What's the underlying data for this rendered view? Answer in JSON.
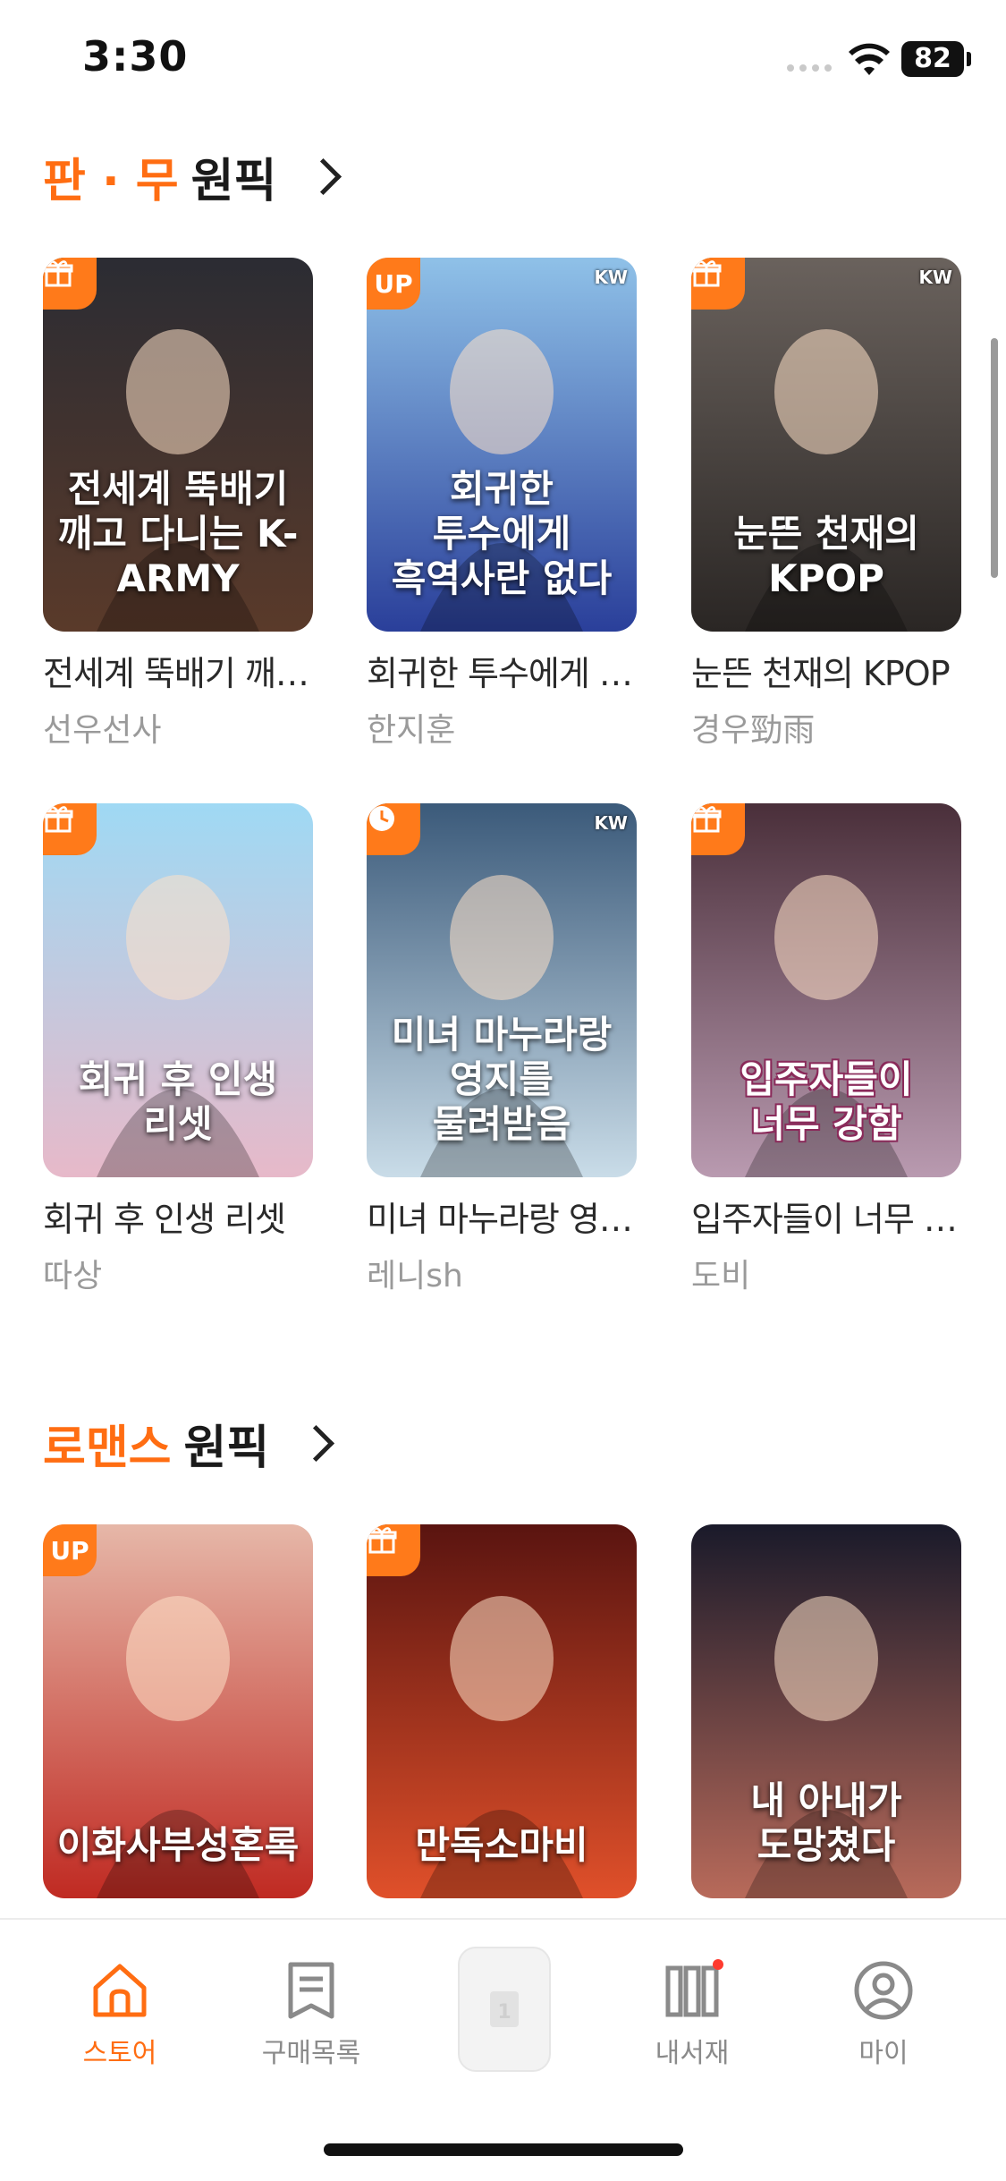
{
  "status": {
    "time": "3:30",
    "battery": "82"
  },
  "sections": [
    {
      "title_accent": "판 · 무",
      "title_rest": "원픽",
      "books": [
        {
          "title": "전세계 뚝배기 깨…",
          "author": "선우선사",
          "badge": "gift",
          "kw": "",
          "cover_text": "전세계 뚝배기 깨고 다니는 K-ARMY",
          "colors": [
            "#2b2c33",
            "#5a3a2a"
          ]
        },
        {
          "title": "회귀한 투수에게 …",
          "author": "한지훈",
          "badge": "UP",
          "kw": "KW",
          "cover_text": "회귀한 투수에게 흑역사란 없다",
          "colors": [
            "#8fc1e8",
            "#2a3f9a"
          ]
        },
        {
          "title": "눈뜬 천재의 KPOP",
          "author": "경우勁雨",
          "badge": "gift",
          "kw": "KW",
          "cover_text": "눈뜬 천재의 KPOP",
          "colors": [
            "#6a625d",
            "#2a2624"
          ]
        },
        {
          "title": "회귀 후 인생 리셋",
          "author": "따상",
          "badge": "gift",
          "kw": "",
          "cover_text": "회귀 후 인생 리셋",
          "colors": [
            "#9fd9f4",
            "#e7b9c9"
          ]
        },
        {
          "title": "미녀 마누라랑 영…",
          "author": "레니sh",
          "badge": "clock",
          "kw": "KW",
          "cover_text": "미녀 마누라랑 영지를 물려받음",
          "colors": [
            "#3b5a7a",
            "#c9dce8"
          ]
        },
        {
          "title": "입주자들이 너무 …",
          "author": "도비",
          "badge": "gift",
          "kw": "",
          "cover_text": "입주자들이 너무 강함",
          "colors": [
            "#4a2f3a",
            "#b99ab0"
          ]
        }
      ]
    },
    {
      "title_accent": "로맨스",
      "title_rest": "원픽",
      "books": [
        {
          "title": "",
          "author": "",
          "badge": "UP",
          "kw": "",
          "cover_text": "이화사부성혼록",
          "colors": [
            "#e6b7a8",
            "#c02a22"
          ]
        },
        {
          "title": "",
          "author": "",
          "badge": "gift",
          "kw": "",
          "cover_text": "만독소마비",
          "colors": [
            "#5a1410",
            "#e0502a"
          ]
        },
        {
          "title": "",
          "author": "",
          "badge": "",
          "kw": "",
          "cover_text": "내 아내가 도망쳤다",
          "colors": [
            "#1a1a2a",
            "#b86a5a"
          ]
        }
      ]
    }
  ],
  "tabbar": {
    "items": [
      {
        "label": "스토어",
        "icon": "home-icon",
        "active": true
      },
      {
        "label": "구매목록",
        "icon": "receipt-icon",
        "active": false
      },
      {
        "label": "",
        "icon": "book-reader-icon",
        "active": false
      },
      {
        "label": "내서재",
        "icon": "library-icon",
        "active": false
      },
      {
        "label": "마이",
        "icon": "profile-icon",
        "active": false
      }
    ]
  },
  "colors": {
    "accent": "#ff6d12",
    "badge": "#ff7a1a",
    "notification_dot": "#ff3b2f"
  }
}
